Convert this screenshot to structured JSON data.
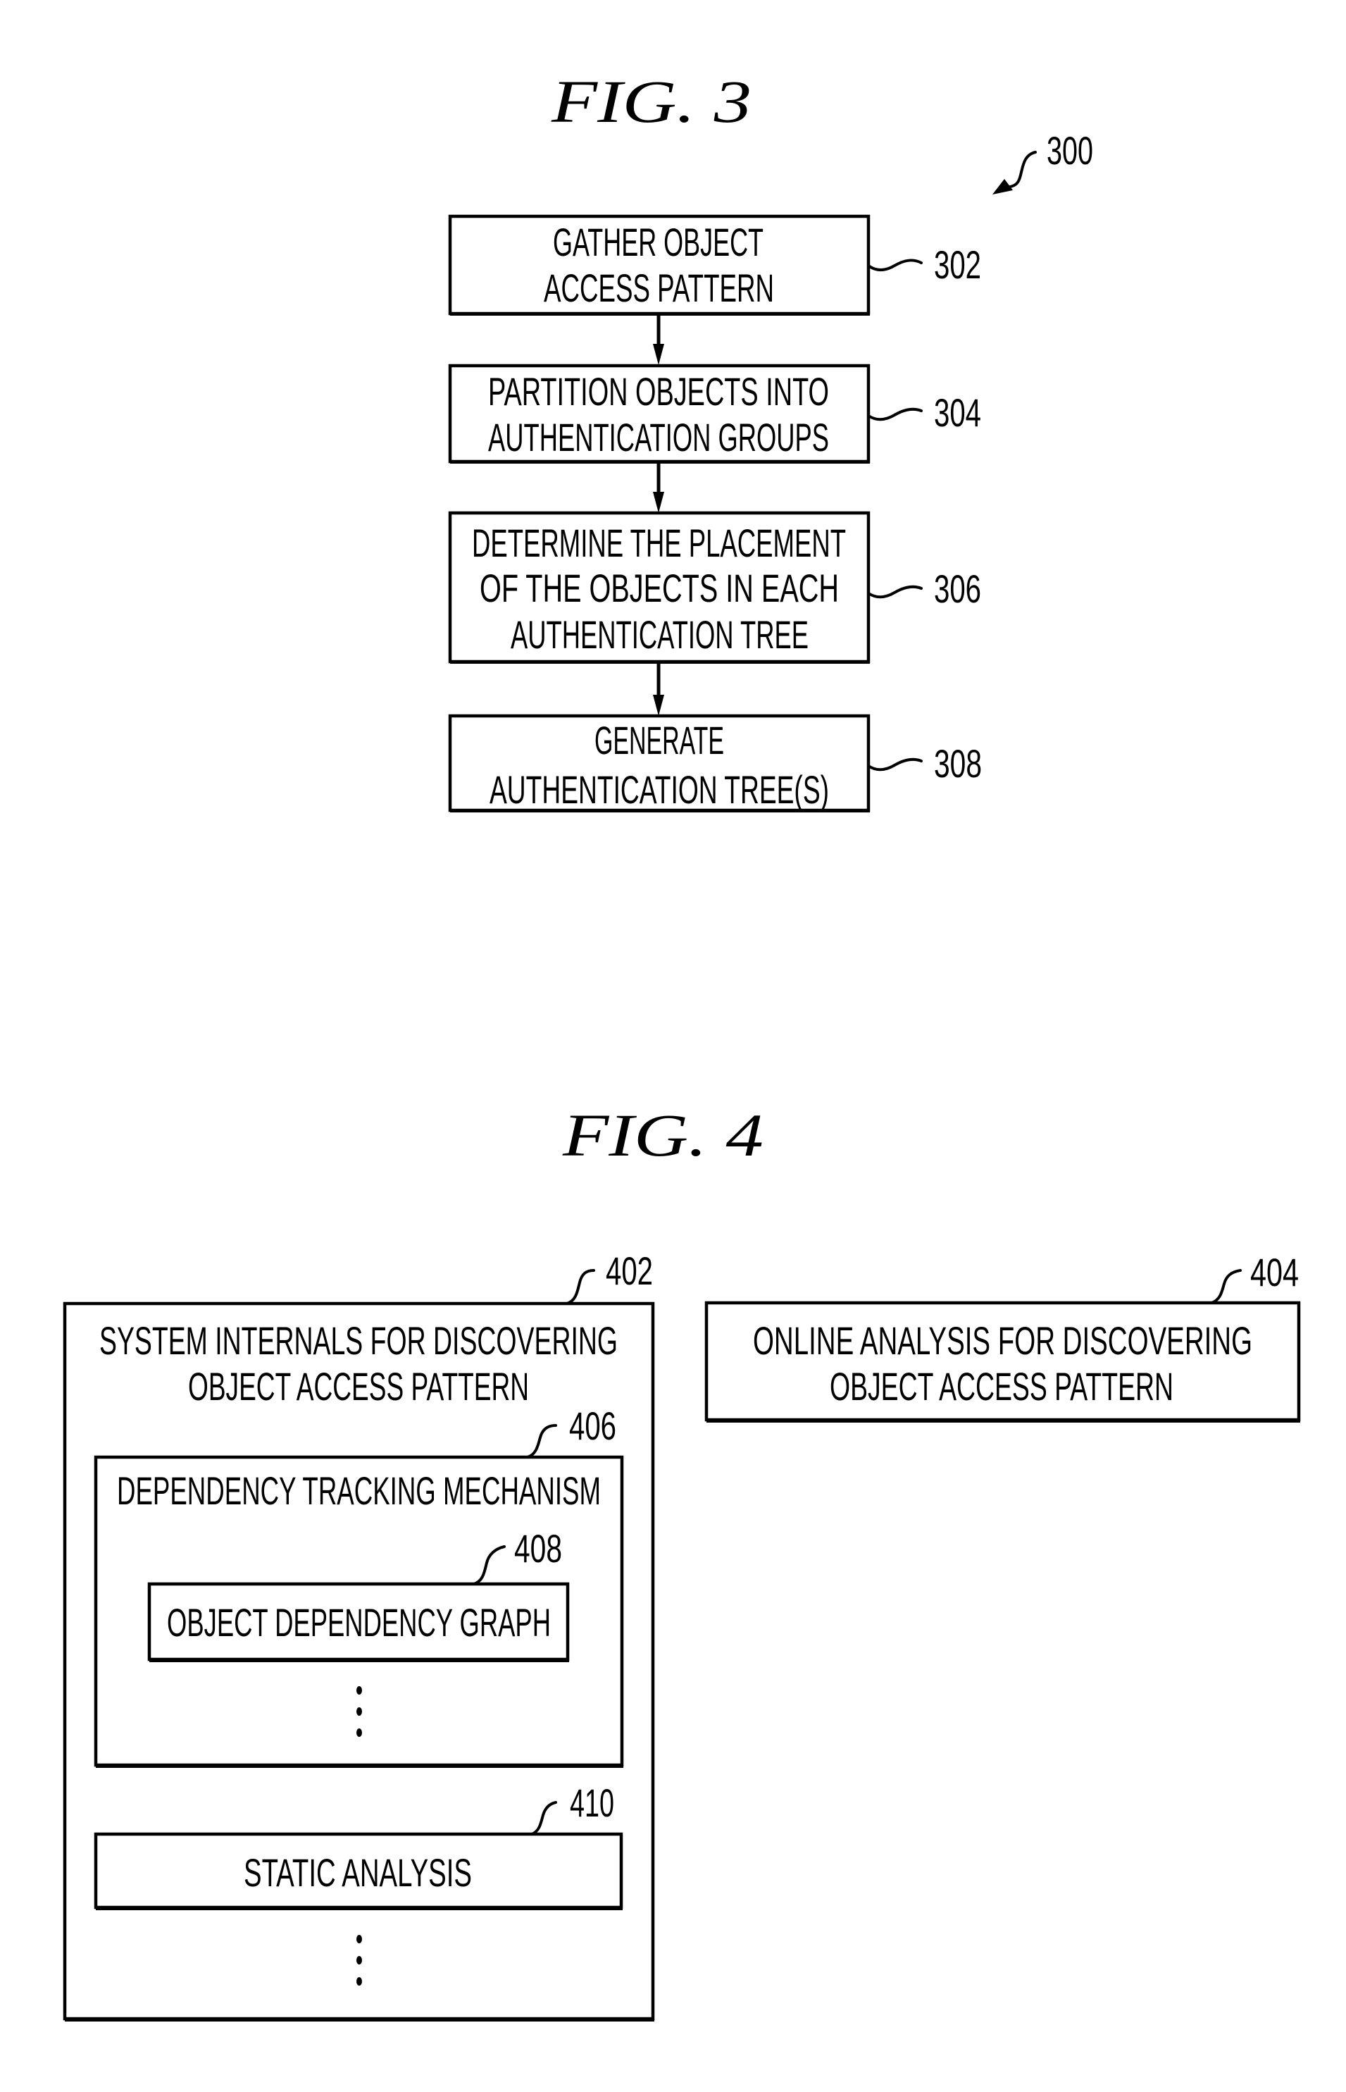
{
  "fig3": {
    "title": "FIG. 3",
    "ref": "300",
    "steps": [
      {
        "ref": "302",
        "lines": [
          "GATHER OBJECT",
          "ACCESS PATTERN"
        ]
      },
      {
        "ref": "304",
        "lines": [
          "PARTITION OBJECTS INTO",
          "AUTHENTICATION GROUPS"
        ]
      },
      {
        "ref": "306",
        "lines": [
          "DETERMINE THE PLACEMENT",
          "OF THE OBJECTS IN EACH",
          "AUTHENTICATION TREE"
        ]
      },
      {
        "ref": "308",
        "lines": [
          "GENERATE",
          "AUTHENTICATION TREE(S)"
        ]
      }
    ]
  },
  "fig4": {
    "title": "FIG. 4",
    "system_internals": {
      "ref": "402",
      "lines": [
        "SYSTEM INTERNALS FOR DISCOVERING",
        "OBJECT ACCESS PATTERN"
      ],
      "dependency_tracking": {
        "ref": "406",
        "label": "DEPENDENCY TRACKING MECHANISM",
        "object_dependency_graph": {
          "ref": "408",
          "label": "OBJECT DEPENDENCY GRAPH"
        }
      },
      "static_analysis": {
        "ref": "410",
        "label": "STATIC ANALYSIS"
      }
    },
    "online_analysis": {
      "ref": "404",
      "lines": [
        "ONLINE ANALYSIS FOR DISCOVERING",
        "OBJECT ACCESS PATTERN"
      ]
    },
    "continuation_marker": "⋮"
  }
}
